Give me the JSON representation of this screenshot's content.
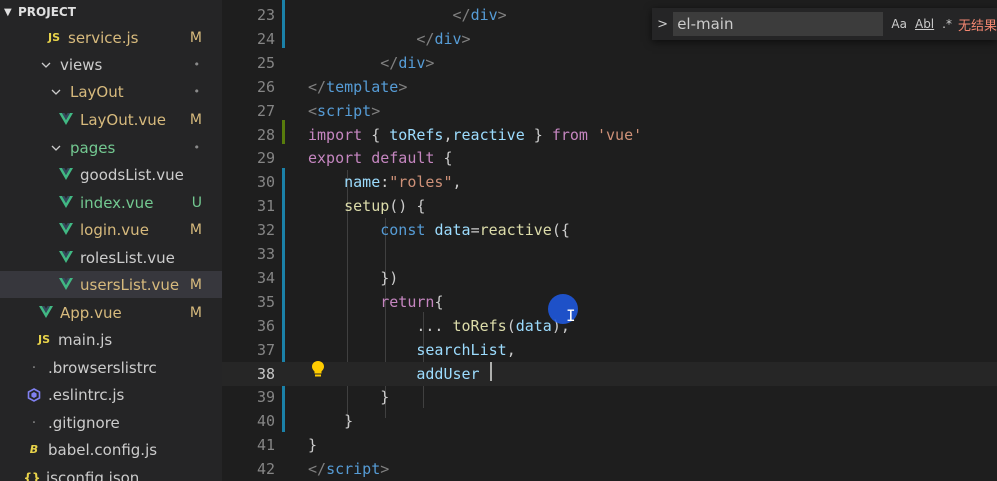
{
  "explorer": {
    "title": "PROJECT",
    "items": [
      {
        "name": "service.js",
        "icon": "js-file-icon",
        "status": "M",
        "kind": "mod"
      },
      {
        "name": "views",
        "icon": "folder-open-arrow",
        "status": "•",
        "kind": "norm"
      },
      {
        "name": "LayOut",
        "icon": "folder-open-arrow",
        "status": "•",
        "kind": "mod"
      },
      {
        "name": "LayOut.vue",
        "icon": "vue-file-icon",
        "status": "M",
        "kind": "mod"
      },
      {
        "name": "pages",
        "icon": "folder-open-arrow",
        "status": "•",
        "kind": "unt"
      },
      {
        "name": "goodsList.vue",
        "icon": "vue-file-icon",
        "status": "",
        "kind": "norm"
      },
      {
        "name": "index.vue",
        "icon": "vue-file-icon",
        "status": "U",
        "kind": "unt"
      },
      {
        "name": "login.vue",
        "icon": "vue-file-icon",
        "status": "M",
        "kind": "mod"
      },
      {
        "name": "rolesList.vue",
        "icon": "vue-file-icon",
        "status": "",
        "kind": "norm"
      },
      {
        "name": "usersList.vue",
        "icon": "vue-file-icon",
        "status": "M",
        "kind": "mod"
      },
      {
        "name": "App.vue",
        "icon": "vue-file-icon",
        "status": "M",
        "kind": "mod"
      },
      {
        "name": "main.js",
        "icon": "js-file-icon",
        "status": "",
        "kind": "norm"
      },
      {
        "name": ".browserslistrc",
        "icon": "dot-file-icon",
        "status": "",
        "kind": "norm"
      },
      {
        "name": ".eslintrc.js",
        "icon": "eslint-icon",
        "status": "",
        "kind": "norm"
      },
      {
        "name": ".gitignore",
        "icon": "dot-file-icon",
        "status": "",
        "kind": "norm"
      },
      {
        "name": "babel.config.js",
        "icon": "babel-icon",
        "status": "",
        "kind": "norm"
      },
      {
        "name": "jsconfig.json",
        "icon": "json-braces-icon",
        "status": "",
        "kind": "norm"
      }
    ]
  },
  "find": {
    "query": "el-main",
    "match_case": "Aa",
    "whole_word": "Abl",
    "regex": ".*",
    "result": "无结果"
  },
  "editor": {
    "lines": [
      {
        "n": "23",
        "tokens": [
          {
            "t": "                ",
            "c": "pun"
          },
          {
            "t": "</",
            "c": "tag"
          },
          {
            "t": "div",
            "c": "tn"
          },
          {
            "t": ">",
            "c": "tag"
          }
        ]
      },
      {
        "n": "24",
        "tokens": [
          {
            "t": "            ",
            "c": "pun"
          },
          {
            "t": "</",
            "c": "tag"
          },
          {
            "t": "div",
            "c": "tn"
          },
          {
            "t": ">",
            "c": "tag"
          }
        ]
      },
      {
        "n": "25",
        "tokens": [
          {
            "t": "        ",
            "c": "pun"
          },
          {
            "t": "</",
            "c": "tag"
          },
          {
            "t": "div",
            "c": "tn"
          },
          {
            "t": ">",
            "c": "tag"
          }
        ]
      },
      {
        "n": "26",
        "tokens": [
          {
            "t": "</",
            "c": "tag"
          },
          {
            "t": "template",
            "c": "tn"
          },
          {
            "t": ">",
            "c": "tag"
          }
        ]
      },
      {
        "n": "27",
        "tokens": [
          {
            "t": "<",
            "c": "tag"
          },
          {
            "t": "script",
            "c": "tn"
          },
          {
            "t": ">",
            "c": "tag"
          }
        ]
      },
      {
        "n": "28",
        "tokens": [
          {
            "t": "import",
            "c": "kw"
          },
          {
            "t": " { ",
            "c": "pun"
          },
          {
            "t": "toRefs",
            "c": "var"
          },
          {
            "t": ",",
            "c": "pun"
          },
          {
            "t": "reactive",
            "c": "var"
          },
          {
            "t": " } ",
            "c": "pun"
          },
          {
            "t": "from",
            "c": "kw"
          },
          {
            "t": " ",
            "c": "pun"
          },
          {
            "t": "'vue'",
            "c": "str"
          }
        ]
      },
      {
        "n": "29",
        "tokens": [
          {
            "t": "export",
            "c": "kw"
          },
          {
            "t": " ",
            "c": "pun"
          },
          {
            "t": "default",
            "c": "kw"
          },
          {
            "t": " {",
            "c": "pun"
          }
        ]
      },
      {
        "n": "30",
        "tokens": [
          {
            "t": "    ",
            "c": "pun"
          },
          {
            "t": "name",
            "c": "var"
          },
          {
            "t": ":",
            "c": "pun"
          },
          {
            "t": "\"roles\"",
            "c": "str"
          },
          {
            "t": ",",
            "c": "pun"
          }
        ]
      },
      {
        "n": "31",
        "tokens": [
          {
            "t": "    ",
            "c": "pun"
          },
          {
            "t": "setup",
            "c": "fn"
          },
          {
            "t": "() {",
            "c": "pun"
          }
        ]
      },
      {
        "n": "32",
        "tokens": [
          {
            "t": "        ",
            "c": "pun"
          },
          {
            "t": "const",
            "c": "kw2"
          },
          {
            "t": " ",
            "c": "pun"
          },
          {
            "t": "data",
            "c": "var"
          },
          {
            "t": "=",
            "c": "pun"
          },
          {
            "t": "reactive",
            "c": "fn"
          },
          {
            "t": "({",
            "c": "pun"
          }
        ]
      },
      {
        "n": "33",
        "tokens": []
      },
      {
        "n": "34",
        "tokens": [
          {
            "t": "        })",
            "c": "pun"
          }
        ]
      },
      {
        "n": "35",
        "tokens": [
          {
            "t": "        ",
            "c": "pun"
          },
          {
            "t": "return",
            "c": "kw"
          },
          {
            "t": "{",
            "c": "pun"
          }
        ]
      },
      {
        "n": "36",
        "tokens": [
          {
            "t": "            ... ",
            "c": "pun"
          },
          {
            "t": "toRefs",
            "c": "fn"
          },
          {
            "t": "(",
            "c": "pun"
          },
          {
            "t": "data",
            "c": "var"
          },
          {
            "t": "),",
            "c": "pun"
          }
        ]
      },
      {
        "n": "37",
        "tokens": [
          {
            "t": "            ",
            "c": "pun"
          },
          {
            "t": "searchList",
            "c": "var"
          },
          {
            "t": ",",
            "c": "pun"
          }
        ]
      },
      {
        "n": "38",
        "tokens": [
          {
            "t": "            ",
            "c": "pun"
          },
          {
            "t": "addUser",
            "c": "var"
          }
        ]
      },
      {
        "n": "39",
        "tokens": [
          {
            "t": "        }",
            "c": "pun"
          }
        ]
      },
      {
        "n": "40",
        "tokens": [
          {
            "t": "    }",
            "c": "pun"
          }
        ]
      },
      {
        "n": "41",
        "tokens": [
          {
            "t": "}",
            "c": "pun"
          }
        ]
      },
      {
        "n": "42",
        "tokens": [
          {
            "t": "</",
            "c": "tag"
          },
          {
            "t": "script",
            "c": "tn"
          },
          {
            "t": ">",
            "c": "tag"
          }
        ]
      }
    ]
  },
  "colors": {
    "modified": "#d7ba7d",
    "untracked": "#73c991",
    "vue_icon": "#41b883",
    "git_gutter_modified": "#1b81a8",
    "git_gutter_added": "#587c0c"
  }
}
